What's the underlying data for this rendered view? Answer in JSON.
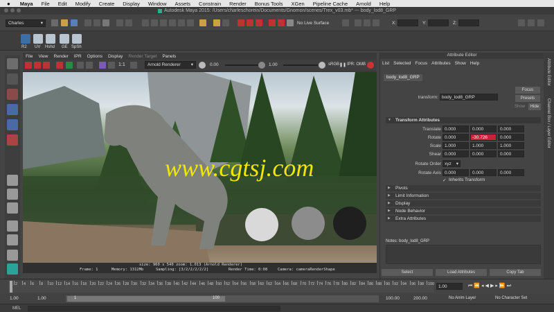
{
  "menubar": {
    "apple": "",
    "app": "Maya",
    "items": [
      "File",
      "Edit",
      "Modify",
      "Create",
      "Display",
      "Window",
      "Assets",
      "Constrain",
      "Render",
      "Bonus Tools",
      "XGen",
      "Pipeline Cache",
      "Arnold",
      "Help"
    ]
  },
  "window_title": "Autodesk Maya 2015: /Users/charleschorein/Documents/Gnomon/scenes/Trex_v03.mb*   ---   body_lod8_GRP",
  "status_line": {
    "menu_set": "Charles",
    "live_surface": "No Live Surface",
    "x_label": "X:",
    "y_label": "Y:",
    "z_label": "Z:"
  },
  "shelf": {
    "items": [
      "R2",
      "UV",
      "Hshd",
      "GE",
      "SpSh"
    ]
  },
  "render_view": {
    "menu": [
      "File",
      "View",
      "Render",
      "IPR",
      "Options",
      "Display",
      "Render Target",
      "Panels"
    ],
    "ratio": "1:1",
    "renderer": "Arnold Renderer",
    "exposure": "0.00",
    "gamma": "1.00",
    "color_space": "sRGB",
    "ipr_label": "IPR: OMB",
    "info_line1": "size: 960 x 540  zoom: 1.013    (Arnold Renderer)",
    "info_frame": "Frame: 1",
    "info_memory": "Memory: 1312Mb",
    "info_sampling": "Sampling: [3/2/2/2/2/2]",
    "info_time": "Render Time: 0:08",
    "info_camera": "Camera: cameraRenderShape"
  },
  "watermark": "www.cgtsj.com",
  "attribute_editor": {
    "header": "Attribute Editor",
    "menu": [
      "List",
      "Selected",
      "Focus",
      "Attributes",
      "Show",
      "Help"
    ],
    "tab": "body_lod8_GRP",
    "transform_label": "transform:",
    "transform_value": "body_lod8_GRP",
    "focus_btn": "Focus",
    "presets_btn": "Presets",
    "show_label": "Show",
    "hide_btn": "Hide",
    "sections": {
      "transform": "Transform Attributes",
      "pivots": "Pivots",
      "limit": "Limit Information",
      "display": "Display",
      "node": "Node Behavior",
      "extra": "Extra Attributes"
    },
    "rows": {
      "translate": {
        "label": "Translate",
        "v": [
          "0.000",
          "0.000",
          "0.000"
        ]
      },
      "rotate": {
        "label": "Rotate",
        "v": [
          "0.000",
          "-30.726",
          "0.000"
        ]
      },
      "scale": {
        "label": "Scale",
        "v": [
          "1.000",
          "1.000",
          "1.000"
        ]
      },
      "shear": {
        "label": "Shear",
        "v": [
          "0.000",
          "0.000",
          "0.000"
        ]
      },
      "rotate_order": {
        "label": "Rotate Order",
        "v": "xyz"
      },
      "rotate_axis": {
        "label": "Rotate Axis",
        "v": [
          "0.000",
          "0.000",
          "0.000"
        ]
      }
    },
    "inherits": "Inherits Transform",
    "notes": "Notes: body_lod8_GRP",
    "select_btn": "Select",
    "load_btn": "Load Attributes",
    "copy_btn": "Copy Tab",
    "side_tabs": [
      "Attribute Editor",
      "Channel Box / Layer Editor"
    ]
  },
  "timeline": {
    "labels": [
      "2",
      "4",
      "6",
      "8",
      "10",
      "12",
      "14",
      "16",
      "18",
      "20",
      "22",
      "24",
      "26",
      "28",
      "30",
      "32",
      "34",
      "36",
      "38",
      "40",
      "42",
      "44",
      "46",
      "48",
      "50",
      "52",
      "54",
      "56",
      "58",
      "60",
      "62",
      "64",
      "66",
      "68",
      "70",
      "72",
      "74",
      "76",
      "78",
      "80",
      "82",
      "84",
      "86",
      "88",
      "90",
      "92",
      "94",
      "96",
      "98",
      "100"
    ],
    "current": "1.00"
  },
  "range": {
    "start": "1.00",
    "playback_start": "1.00",
    "slider_start": "1",
    "slider_end": "100",
    "playback_end": "100.00",
    "end": "200.00",
    "anim_layer": "No Anim Layer",
    "char_set": "No Character Set"
  },
  "mel": "MEL"
}
